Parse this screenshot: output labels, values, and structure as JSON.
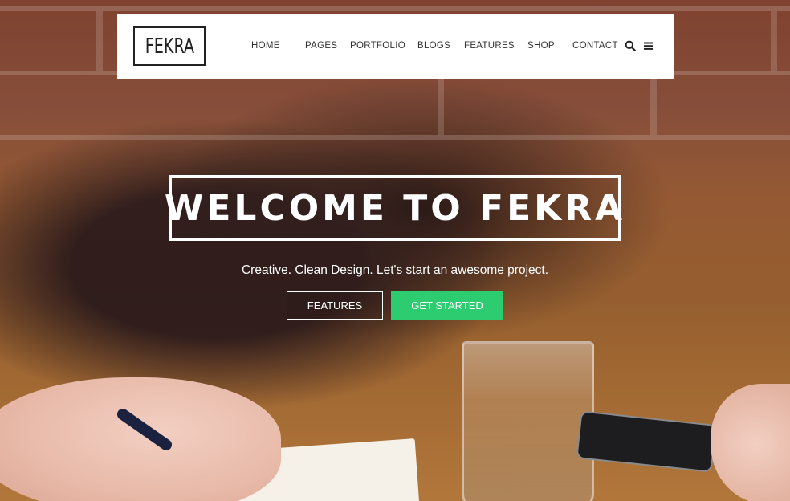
{
  "header": {
    "logo_text": "FEKRA",
    "nav": [
      {
        "label": "HOME"
      },
      {
        "label": "PAGES"
      },
      {
        "label": "PORTFOLIO"
      },
      {
        "label": "BLOGS"
      },
      {
        "label": "FEATURES"
      },
      {
        "label": "SHOP"
      },
      {
        "label": "CONTACT"
      }
    ],
    "icons": [
      "search-icon",
      "menu-icon"
    ]
  },
  "hero": {
    "title": "WELCOME TO FEKRA",
    "tagline": "Creative. Clean Design. Let's start an awesome project.",
    "buttons": {
      "features_label": "FEATURES",
      "get_started_label": "GET STARTED"
    }
  },
  "colors": {
    "accent": "#2ecc71",
    "header_bg": "#ffffff",
    "text_dark": "#333333"
  }
}
